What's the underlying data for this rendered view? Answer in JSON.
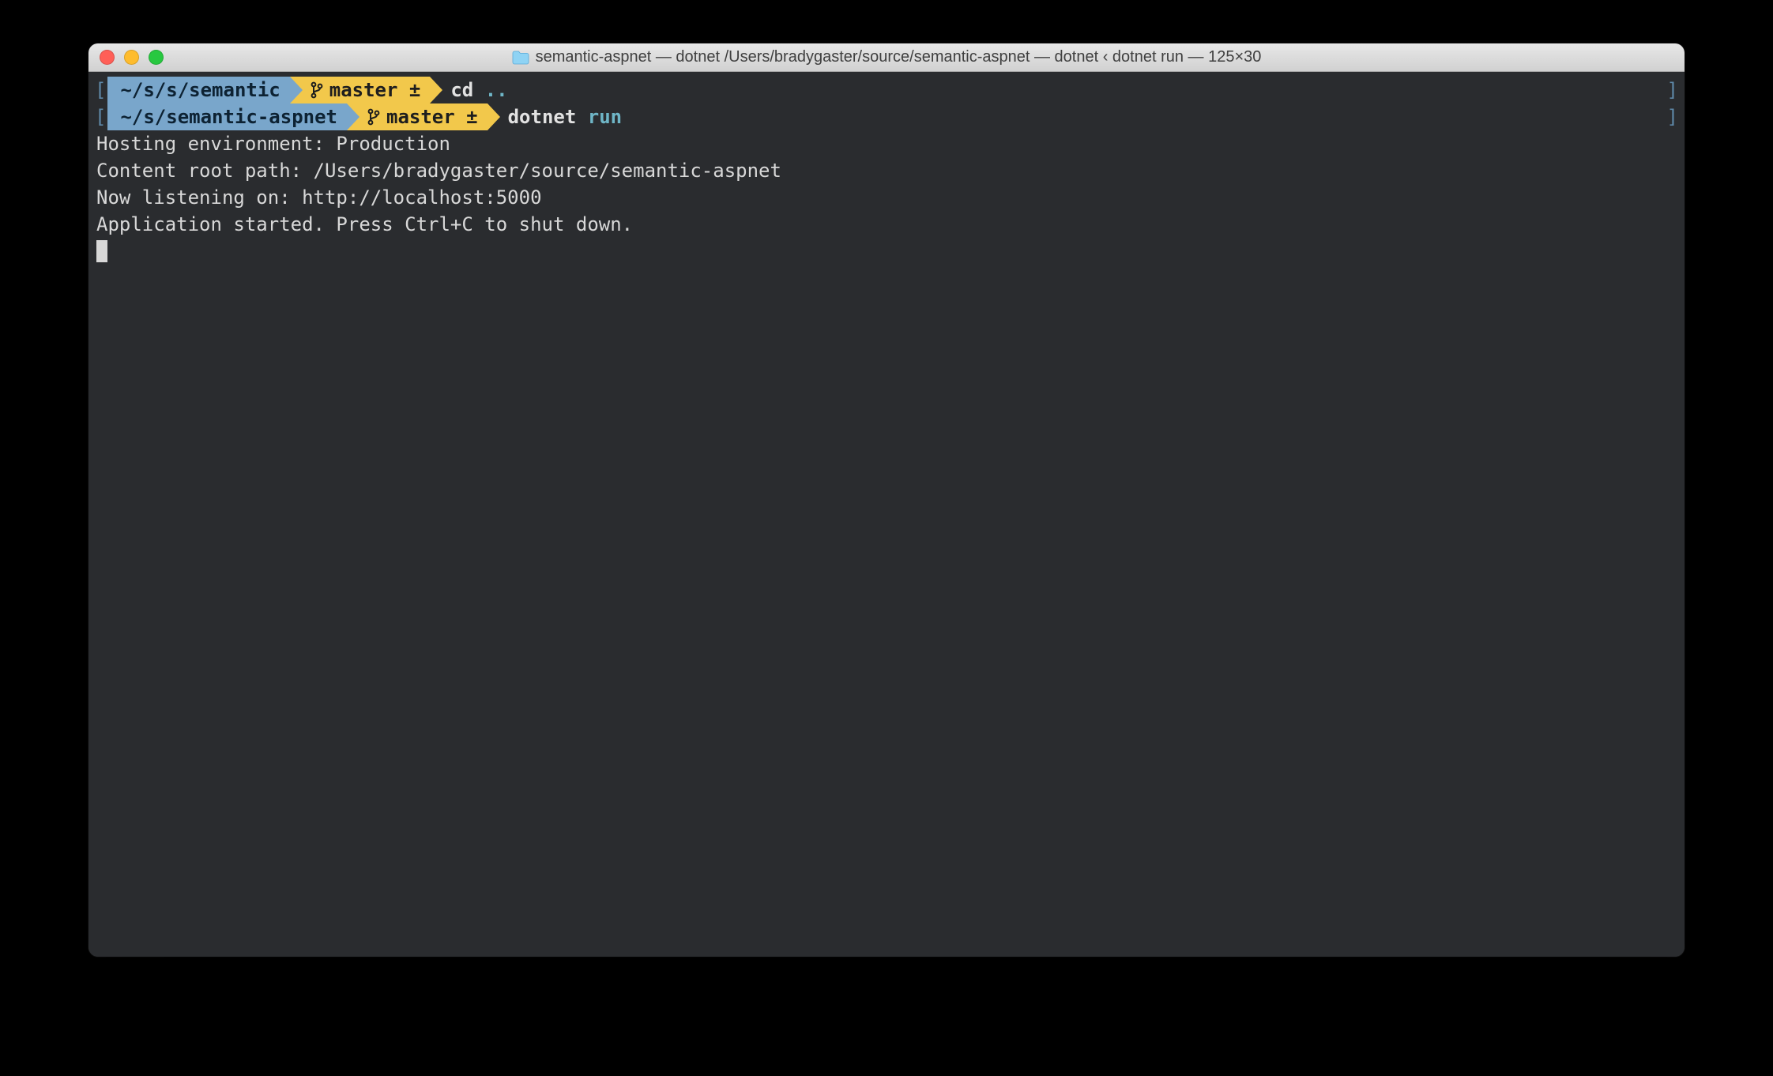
{
  "window": {
    "title": "semantic-aspnet — dotnet  /Users/bradygaster/source/semantic-aspnet — dotnet ‹ dotnet run — 125×30"
  },
  "prompt1": {
    "path": "~/s/s/semantic",
    "branch": "master",
    "dirty": "±",
    "cmd": "cd",
    "arg": ".."
  },
  "prompt2": {
    "path": "~/s/semantic-aspnet",
    "branch": "master",
    "dirty": "±",
    "cmd": "dotnet",
    "arg": "run"
  },
  "output": {
    "l1": "Hosting environment: Production",
    "l2": "Content root path: /Users/bradygaster/source/semantic-aspnet",
    "l3": "Now listening on: http://localhost:5000",
    "l4": "Application started. Press Ctrl+C to shut down."
  },
  "brackets": {
    "open": "[",
    "close": "]"
  }
}
